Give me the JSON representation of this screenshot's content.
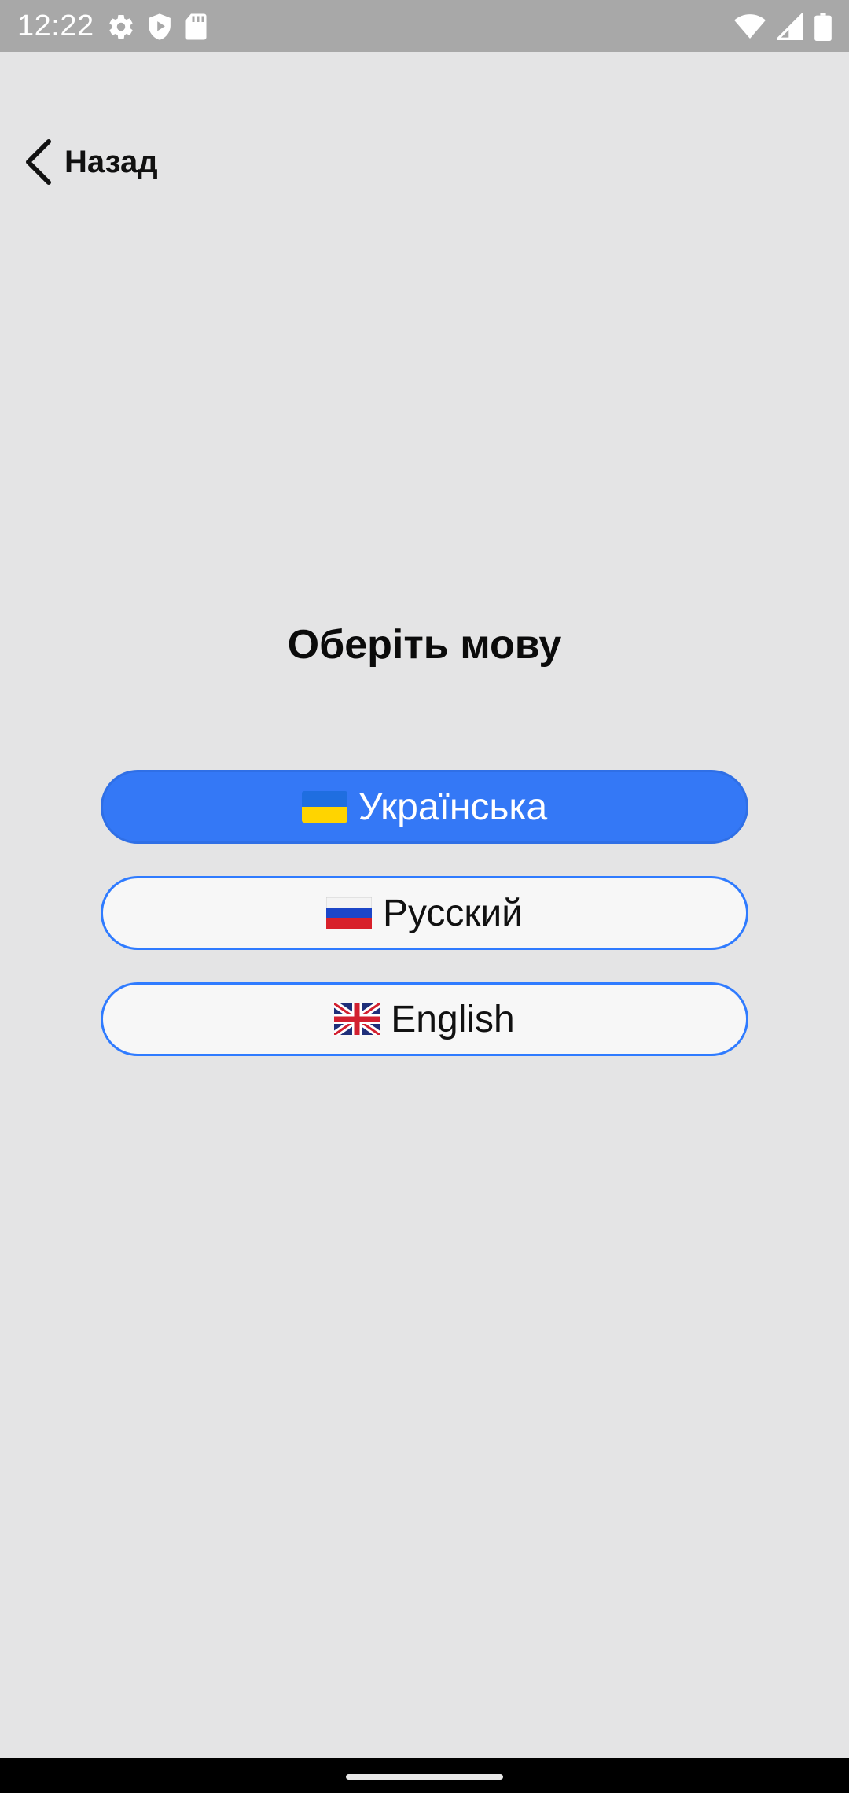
{
  "status_bar": {
    "time": "12:22",
    "left_icons": [
      "settings-icon",
      "shield-play-icon",
      "sd-card-icon"
    ],
    "right_icons": [
      "wifi-icon",
      "signal-icon",
      "battery-icon"
    ]
  },
  "header": {
    "back_label": "Назад"
  },
  "main": {
    "title": "Оберіть мову",
    "languages": [
      {
        "flag": "ukraine-flag-icon",
        "label": "Українська",
        "selected": true
      },
      {
        "flag": "russia-flag-icon",
        "label": "Русский",
        "selected": false
      },
      {
        "flag": "uk-flag-icon",
        "label": "English",
        "selected": false
      }
    ]
  },
  "colors": {
    "background": "#e4e4e5",
    "accent": "#3478f6",
    "button_border": "#2f7bff",
    "status_bar": "#a8a8a8"
  }
}
